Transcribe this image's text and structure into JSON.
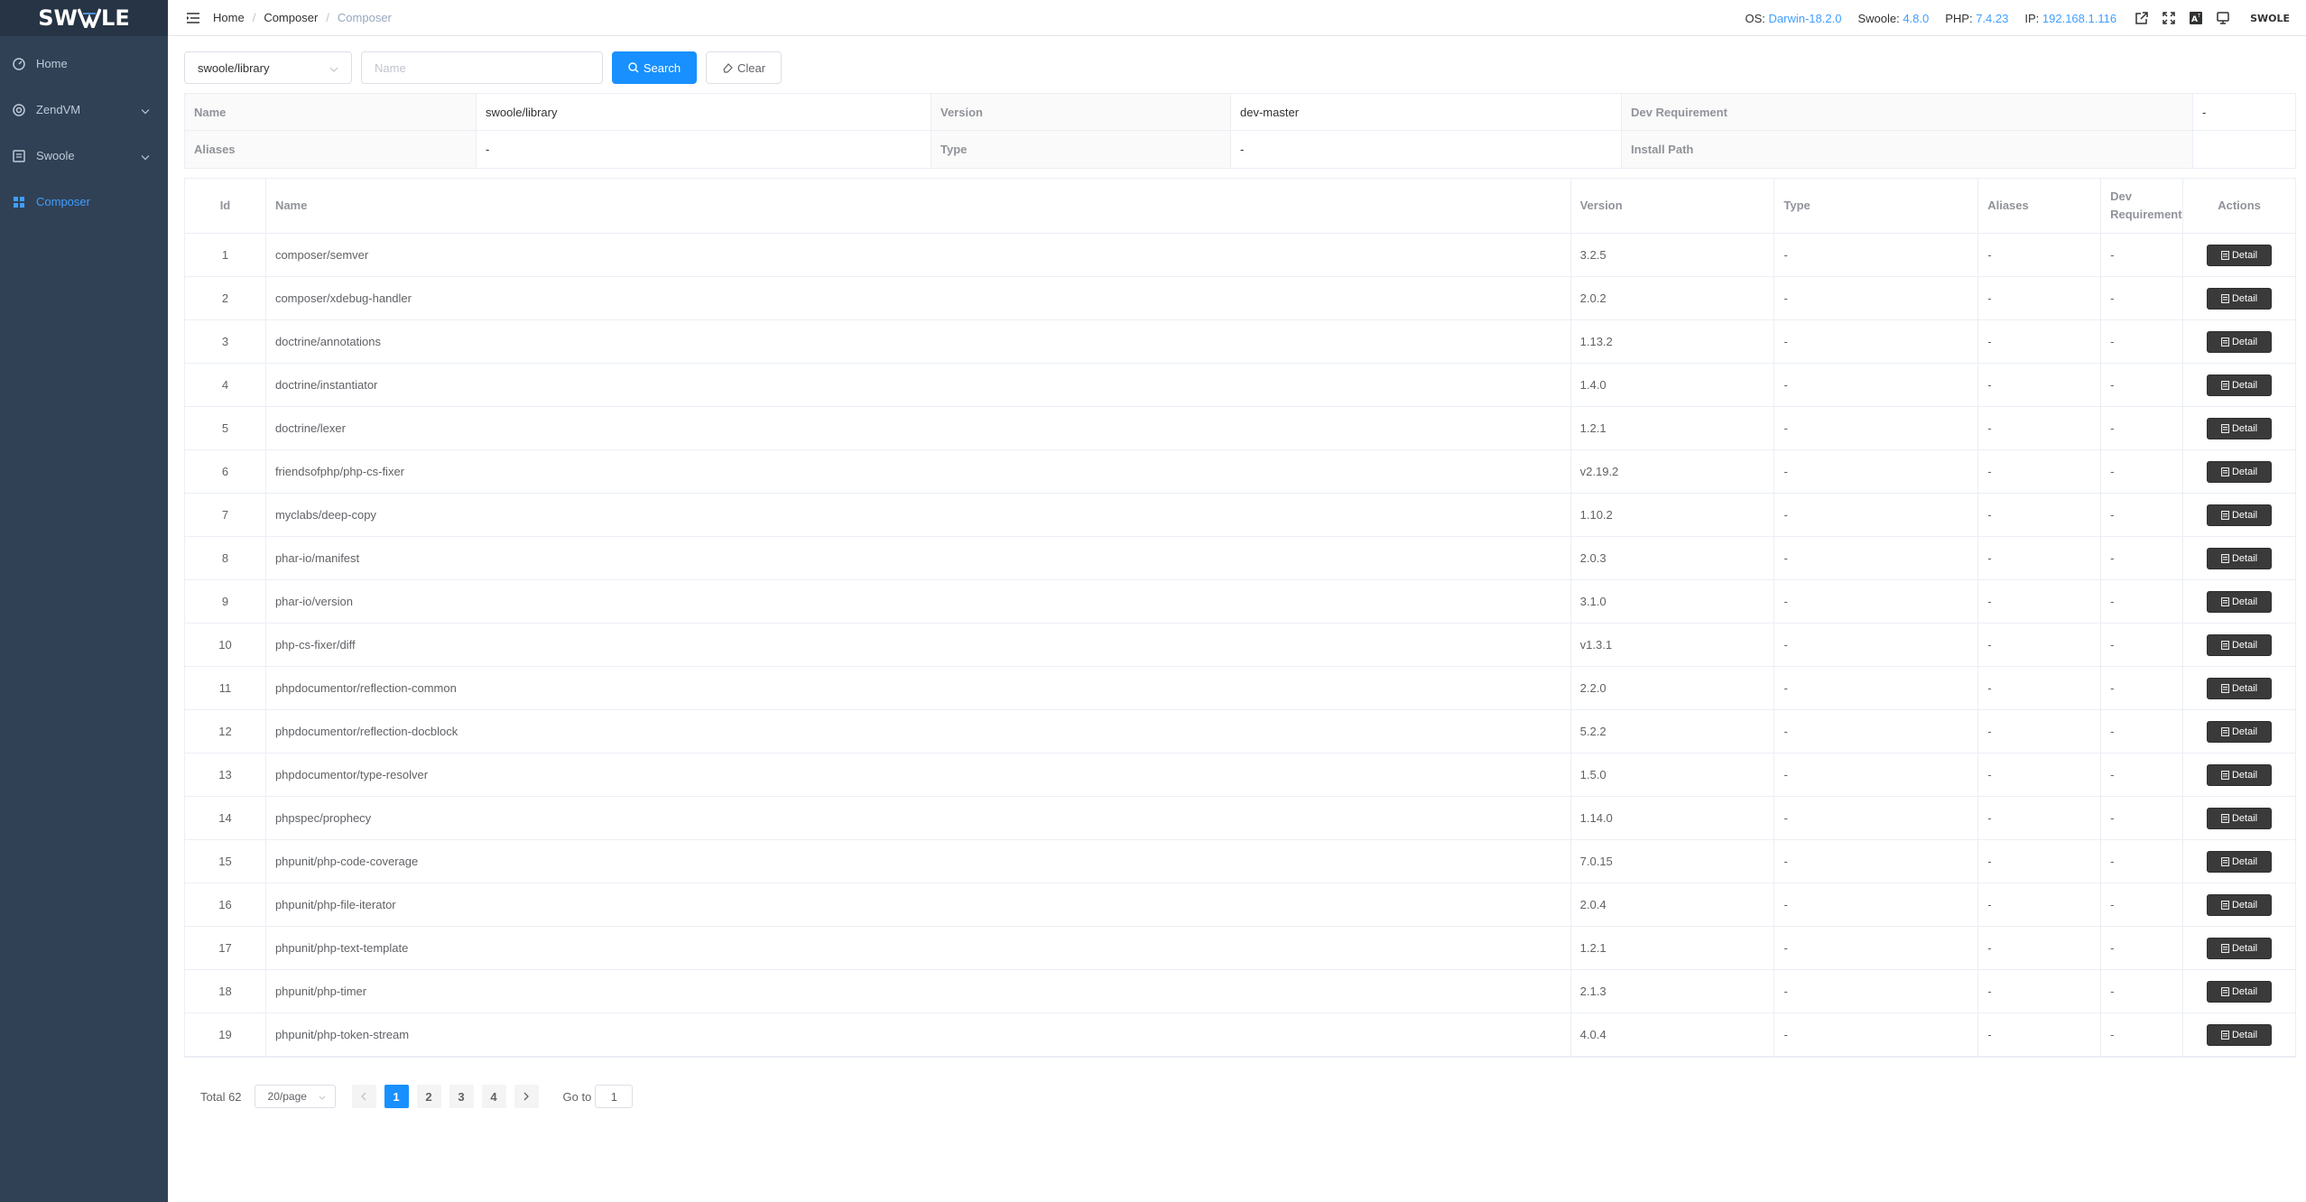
{
  "app": {
    "logo_text": "SWOOLE",
    "logo_left": "SW",
    "logo_right": "LE"
  },
  "sidebar": {
    "items": [
      {
        "label": "Home",
        "icon": "dashboard-icon"
      },
      {
        "label": "ZendVM",
        "icon": "target-icon"
      },
      {
        "label": "Swoole",
        "icon": "box-icon"
      },
      {
        "label": "Composer",
        "icon": "grid-icon"
      }
    ]
  },
  "breadcrumb": {
    "items": [
      "Home",
      "Composer",
      "Composer"
    ]
  },
  "header": {
    "os_label": "OS:",
    "os_value": "Darwin-18.2.0",
    "swoole_label": "Swoole:",
    "swoole_value": "4.8.0",
    "php_label": "PHP:",
    "php_value": "7.4.23",
    "ip_label": "IP:",
    "ip_value": "192.168.1.116",
    "logo_text": "SWOLE"
  },
  "search": {
    "select_value": "swoole/library",
    "name_placeholder": "Name",
    "search_label": "Search",
    "clear_label": "Clear"
  },
  "summary": {
    "name_label": "Name",
    "name_value": "swoole/library",
    "version_label": "Version",
    "version_value": "dev-master",
    "devreq_label": "Dev Requirement",
    "devreq_value": "-",
    "aliases_label": "Aliases",
    "aliases_value": "-",
    "type_label": "Type",
    "type_value": "-",
    "path_label": "Install Path",
    "path_value": ""
  },
  "table": {
    "headers": {
      "id": "Id",
      "name": "Name",
      "version": "Version",
      "type": "Type",
      "aliases": "Aliases",
      "dev": "Dev Requirement",
      "actions": "Actions"
    },
    "detail_label": "Detail",
    "rows": [
      {
        "id": "1",
        "name": "composer/semver",
        "version": "3.2.5",
        "type": "-",
        "aliases": "-",
        "dev": "-"
      },
      {
        "id": "2",
        "name": "composer/xdebug-handler",
        "version": "2.0.2",
        "type": "-",
        "aliases": "-",
        "dev": "-"
      },
      {
        "id": "3",
        "name": "doctrine/annotations",
        "version": "1.13.2",
        "type": "-",
        "aliases": "-",
        "dev": "-"
      },
      {
        "id": "4",
        "name": "doctrine/instantiator",
        "version": "1.4.0",
        "type": "-",
        "aliases": "-",
        "dev": "-"
      },
      {
        "id": "5",
        "name": "doctrine/lexer",
        "version": "1.2.1",
        "type": "-",
        "aliases": "-",
        "dev": "-"
      },
      {
        "id": "6",
        "name": "friendsofphp/php-cs-fixer",
        "version": "v2.19.2",
        "type": "-",
        "aliases": "-",
        "dev": "-"
      },
      {
        "id": "7",
        "name": "myclabs/deep-copy",
        "version": "1.10.2",
        "type": "-",
        "aliases": "-",
        "dev": "-"
      },
      {
        "id": "8",
        "name": "phar-io/manifest",
        "version": "2.0.3",
        "type": "-",
        "aliases": "-",
        "dev": "-"
      },
      {
        "id": "9",
        "name": "phar-io/version",
        "version": "3.1.0",
        "type": "-",
        "aliases": "-",
        "dev": "-"
      },
      {
        "id": "10",
        "name": "php-cs-fixer/diff",
        "version": "v1.3.1",
        "type": "-",
        "aliases": "-",
        "dev": "-"
      },
      {
        "id": "11",
        "name": "phpdocumentor/reflection-common",
        "version": "2.2.0",
        "type": "-",
        "aliases": "-",
        "dev": "-"
      },
      {
        "id": "12",
        "name": "phpdocumentor/reflection-docblock",
        "version": "5.2.2",
        "type": "-",
        "aliases": "-",
        "dev": "-"
      },
      {
        "id": "13",
        "name": "phpdocumentor/type-resolver",
        "version": "1.5.0",
        "type": "-",
        "aliases": "-",
        "dev": "-"
      },
      {
        "id": "14",
        "name": "phpspec/prophecy",
        "version": "1.14.0",
        "type": "-",
        "aliases": "-",
        "dev": "-"
      },
      {
        "id": "15",
        "name": "phpunit/php-code-coverage",
        "version": "7.0.15",
        "type": "-",
        "aliases": "-",
        "dev": "-"
      },
      {
        "id": "16",
        "name": "phpunit/php-file-iterator",
        "version": "2.0.4",
        "type": "-",
        "aliases": "-",
        "dev": "-"
      },
      {
        "id": "17",
        "name": "phpunit/php-text-template",
        "version": "1.2.1",
        "type": "-",
        "aliases": "-",
        "dev": "-"
      },
      {
        "id": "18",
        "name": "phpunit/php-timer",
        "version": "2.1.3",
        "type": "-",
        "aliases": "-",
        "dev": "-"
      },
      {
        "id": "19",
        "name": "phpunit/php-token-stream",
        "version": "4.0.4",
        "type": "-",
        "aliases": "-",
        "dev": "-"
      }
    ]
  },
  "pagination": {
    "total_label": "Total 62",
    "page_size": "20/page",
    "pages": [
      "1",
      "2",
      "3",
      "4"
    ],
    "active_page": "1",
    "goto_label": "Go to",
    "goto_value": "1"
  },
  "colors": {
    "sidebar_bg": "#304156",
    "accent": "#1890ff",
    "link": "#409eff",
    "detail_btn": "#3a3a3a"
  }
}
